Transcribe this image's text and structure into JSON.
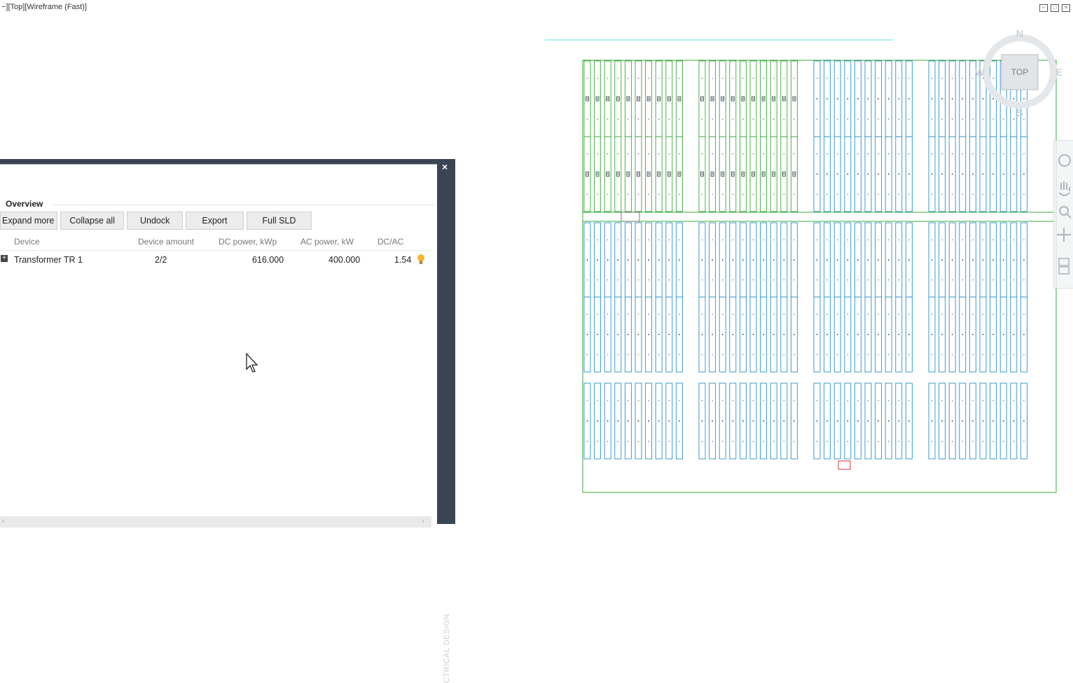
{
  "viewport": {
    "label": "−][Top][Wireframe (Fast)]"
  },
  "window_controls": [
    "minimize-icon",
    "restore-icon",
    "close-icon"
  ],
  "palette": {
    "side_title": "CTRICAL DESIGN",
    "close_glyph": "×",
    "section": {
      "title": "Overview"
    },
    "toolbar": {
      "expand_more": "Expand more",
      "collapse_all": "Collapse all",
      "undock": "Undock",
      "export": "Export",
      "full_sld": "Full SLD"
    },
    "table": {
      "columns": [
        "Device",
        "Device amount",
        "DC power, kWp",
        "AC power, kW",
        "DC/AC"
      ],
      "rows": [
        {
          "device": "Transformer TR 1",
          "device_amount": "2/2",
          "dc_power": "616.000",
          "ac_power": "400.000",
          "dc_ac": "1.54",
          "status_icon": "lightbulb-icon"
        }
      ]
    },
    "scrollbar": {
      "left": "‹",
      "right": "›"
    }
  },
  "viewcube": {
    "north": "N",
    "south": "S",
    "east": "E",
    "west": "W",
    "face": "TOP"
  },
  "colors": {
    "panel_blue": "#2a8fc8",
    "boundary_green": "#3aa83a",
    "cyan_line": "#5fe0e0",
    "palette_dark": "#3b4453",
    "marker_red": "#e03030"
  }
}
